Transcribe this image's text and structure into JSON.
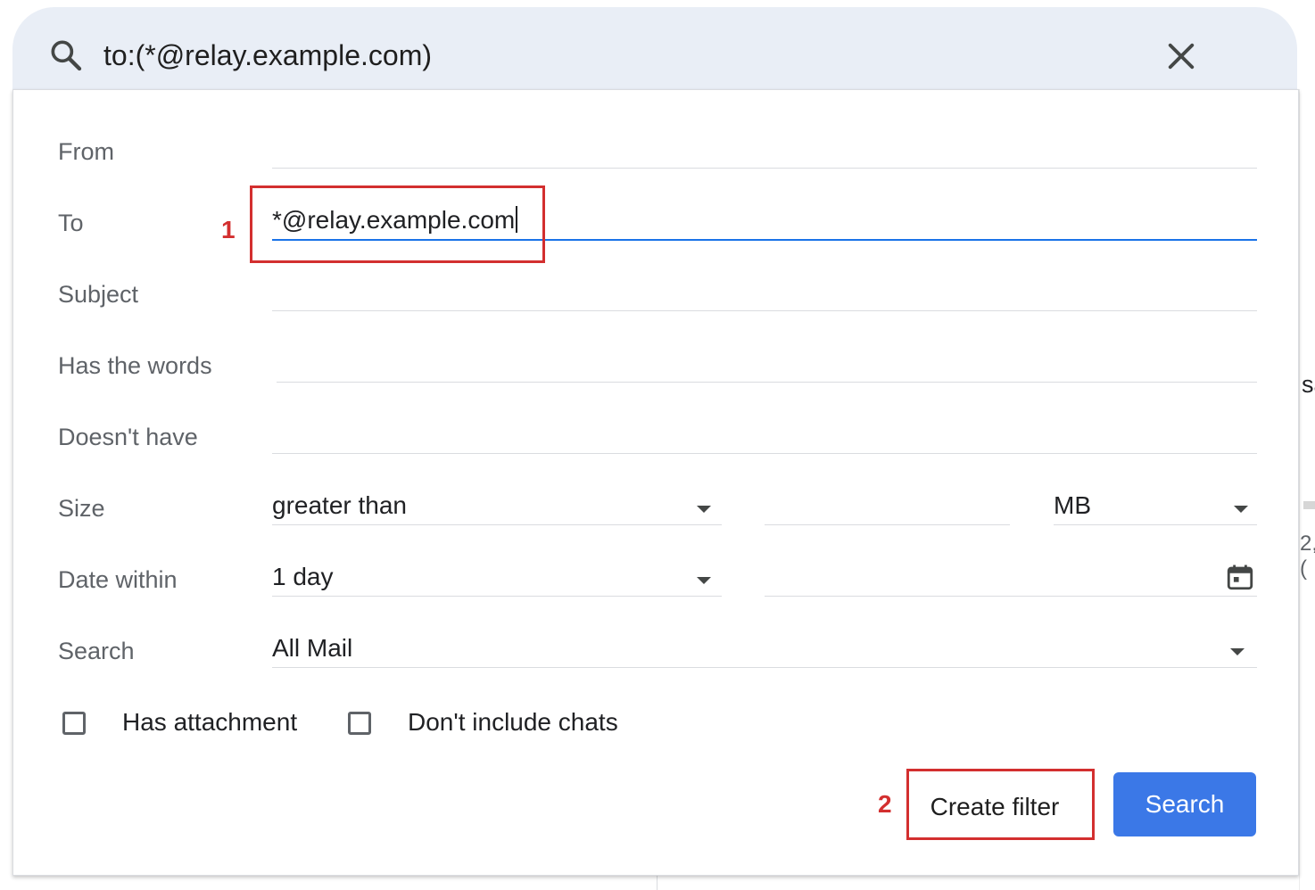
{
  "search": {
    "query": "to:(*@relay.example.com)",
    "search_icon": "search-icon",
    "clear_icon": "close-icon"
  },
  "form": {
    "from": {
      "label": "From",
      "value": ""
    },
    "to": {
      "label": "To",
      "value": "*@relay.example.com"
    },
    "subject": {
      "label": "Subject",
      "value": ""
    },
    "has_words": {
      "label": "Has the words",
      "value": ""
    },
    "doesnt_have": {
      "label": "Doesn't have",
      "value": ""
    },
    "size": {
      "label": "Size",
      "comparator": "greater than",
      "amount": "",
      "unit": "MB"
    },
    "date_within": {
      "label": "Date within",
      "value": "1 day",
      "date": "",
      "calendar_icon": "calendar-icon"
    },
    "search_in": {
      "label": "Search",
      "value": "All Mail"
    },
    "has_attachment": {
      "label": "Has attachment",
      "checked": false
    },
    "no_chats": {
      "label": "Don't include chats",
      "checked": false
    }
  },
  "actions": {
    "create_filter": "Create filter",
    "search": "Search"
  },
  "annotations": {
    "step1": "1",
    "step2": "2"
  },
  "background": {
    "fragment_1": "sa",
    "fragment_2": "2,("
  },
  "colors": {
    "search_bar_bg": "#e9eef6",
    "accent_blue": "#1a73e8",
    "search_button": "#3b78e7",
    "annotation_red": "#d32f2f"
  }
}
